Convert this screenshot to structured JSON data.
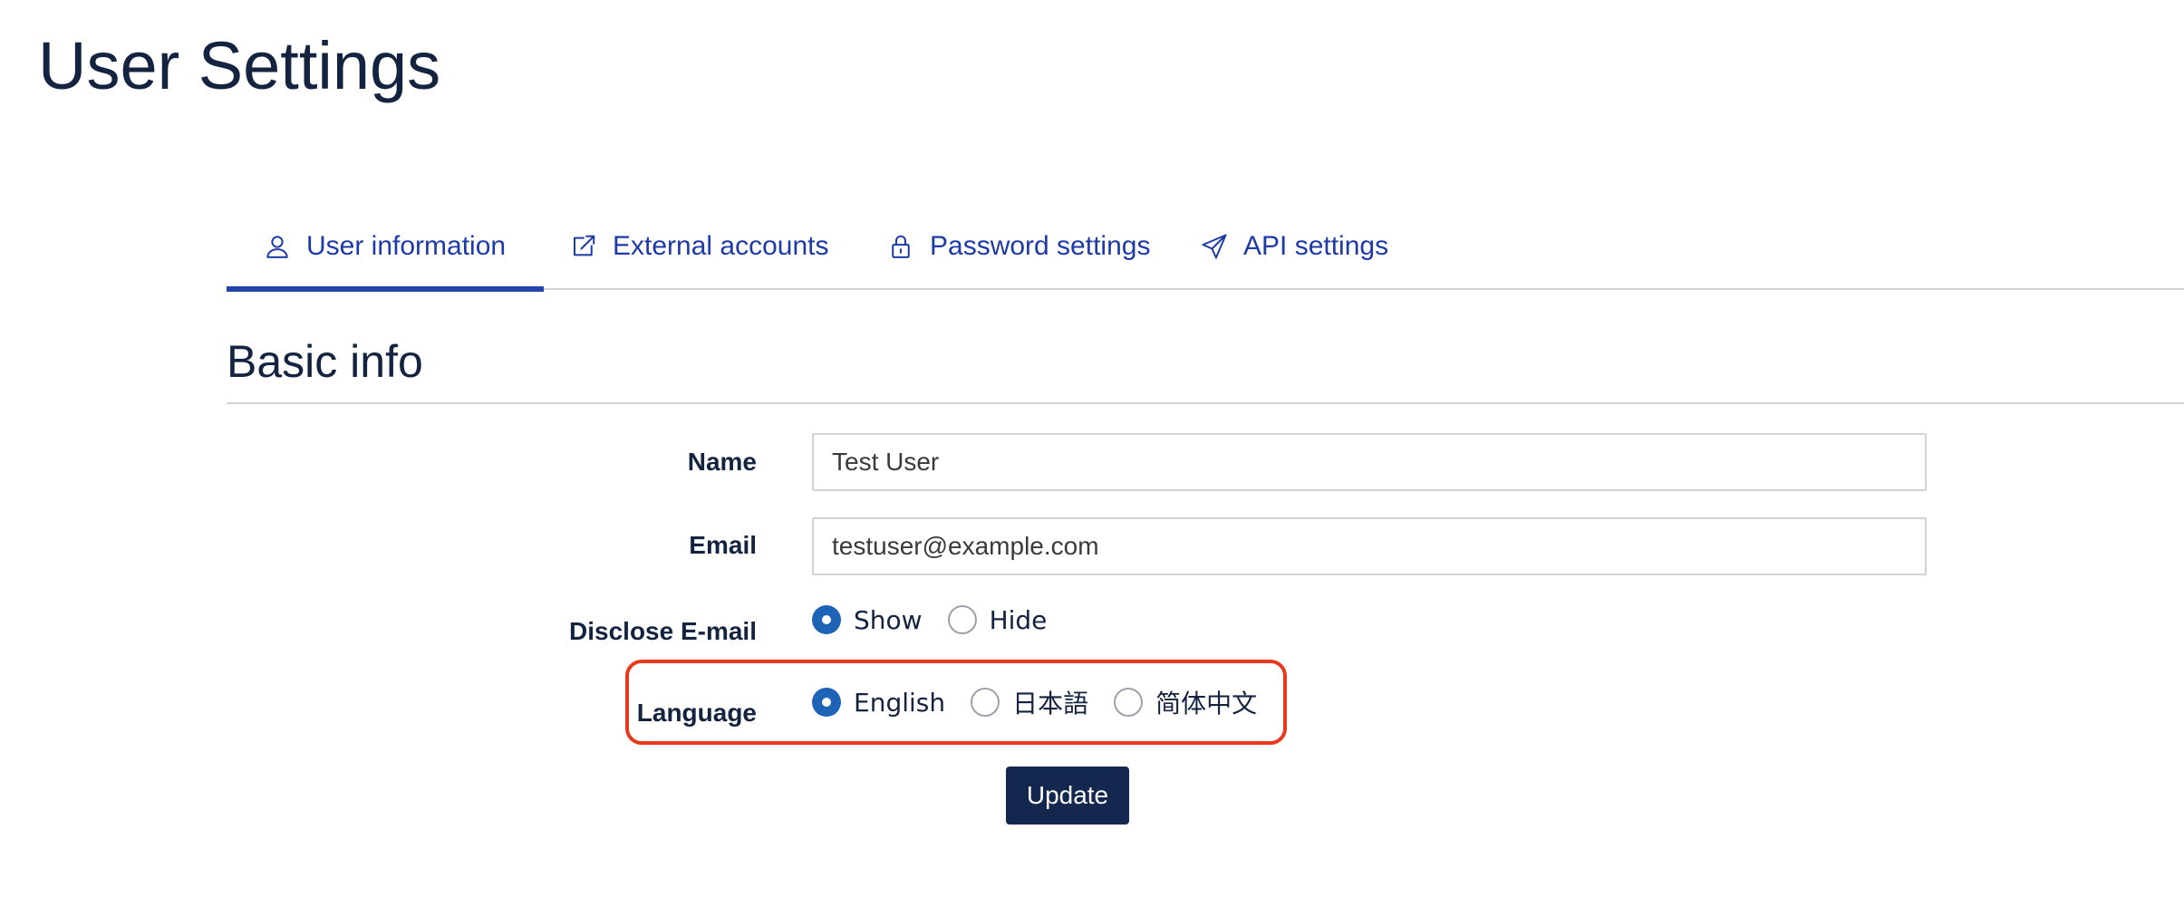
{
  "page": {
    "title": "User Settings"
  },
  "tabs": [
    {
      "label": "User information",
      "icon": "user-icon",
      "active": true
    },
    {
      "label": "External accounts",
      "icon": "external-link-icon",
      "active": false
    },
    {
      "label": "Password settings",
      "icon": "lock-icon",
      "active": false
    },
    {
      "label": "API settings",
      "icon": "paper-plane-icon",
      "active": false
    }
  ],
  "basic_info": {
    "section_title": "Basic info",
    "name": {
      "label": "Name",
      "value": "Test User"
    },
    "email": {
      "label": "Email",
      "value": "testuser@example.com"
    },
    "disclose_email": {
      "label": "Disclose E-mail",
      "options": [
        {
          "label": "Show",
          "checked": true
        },
        {
          "label": "Hide",
          "checked": false
        }
      ]
    },
    "language": {
      "label": "Language",
      "options": [
        {
          "label": "English",
          "checked": true
        },
        {
          "label": "日本語",
          "checked": false
        },
        {
          "label": "简体中文",
          "checked": false
        }
      ]
    },
    "update_label": "Update"
  },
  "colors": {
    "tab_text": "#1d3aa6",
    "active_tab_underline": "#2444ad",
    "radio_checked": "#1e63b5",
    "button_bg": "#14284f",
    "highlight": "#e8381d"
  }
}
